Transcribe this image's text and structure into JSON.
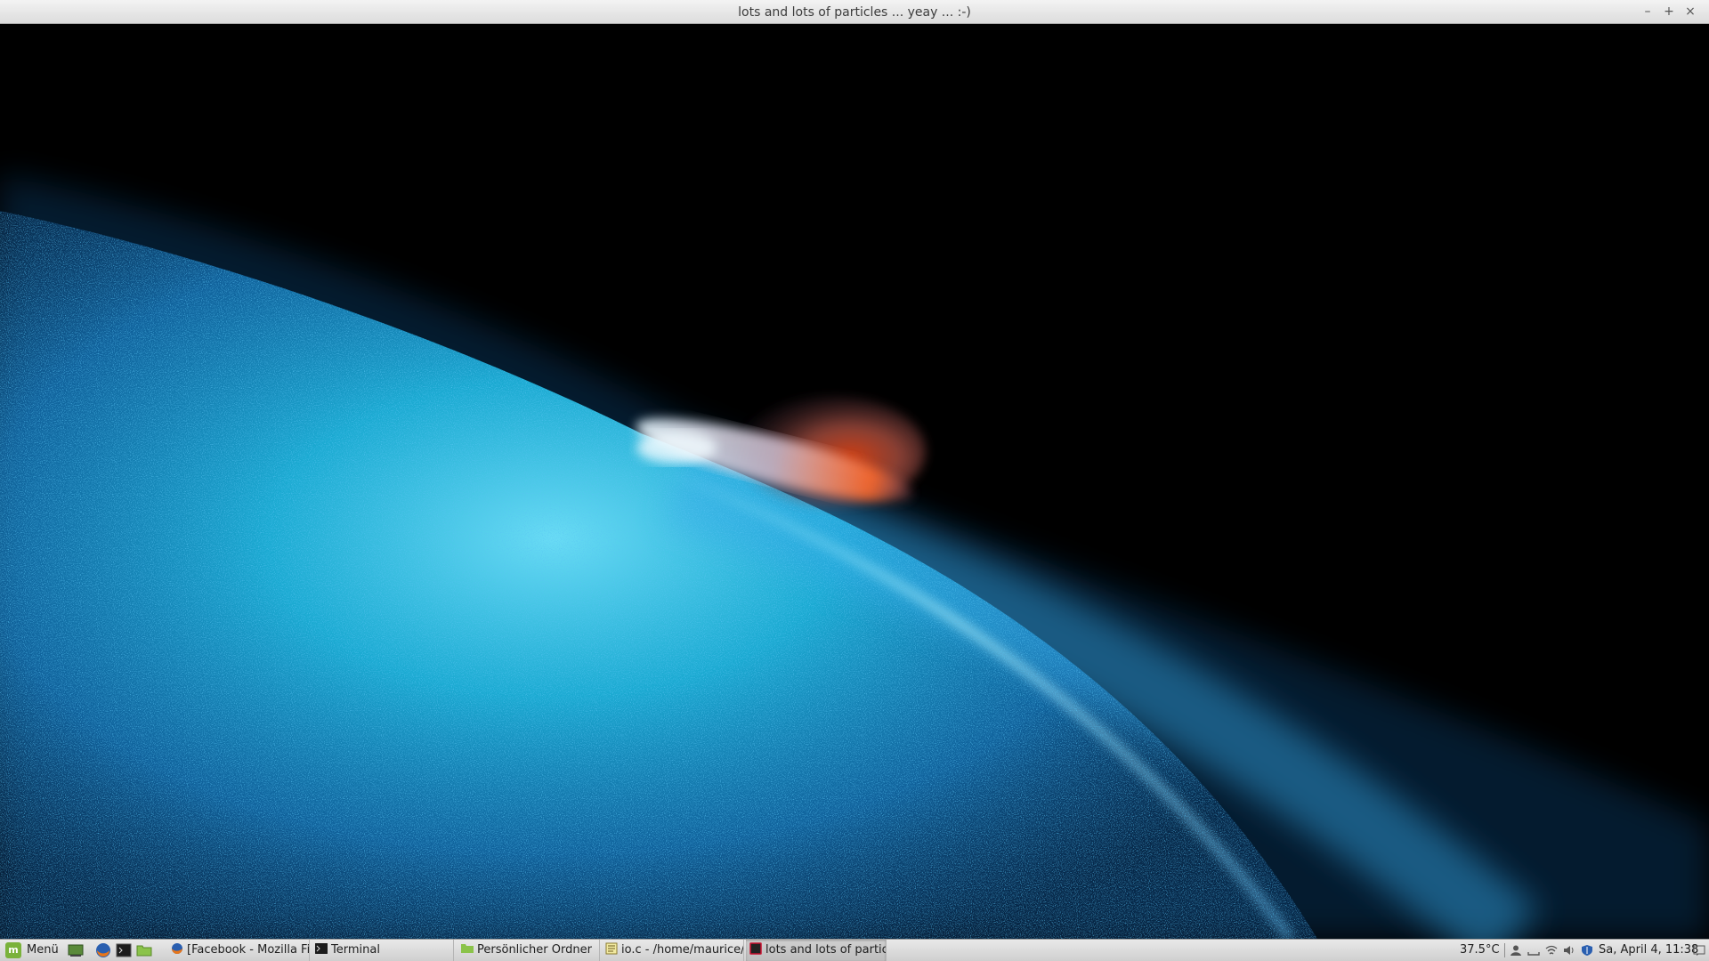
{
  "window": {
    "title": "lots and lots of particles ... yeay ... :-)",
    "controls": {
      "minimize": "–",
      "maximize": "+",
      "close": "×"
    }
  },
  "scene": {
    "background": "#000000",
    "particle_colors": {
      "main_cyan": "#1ec8f0",
      "main_blue": "#1a73c8",
      "bright_core": "#bff5ff",
      "ember_orange": "#ff5a1e",
      "ember_pale": "#e8c8d8"
    }
  },
  "taskbar": {
    "menu_label": "Menü",
    "launchers": [
      "show-desktop-icon",
      "firefox-icon",
      "terminal-icon",
      "files-icon"
    ],
    "tasks": [
      {
        "label": "[Facebook - Mozilla Fi...",
        "icon": "firefox-icon"
      },
      {
        "label": "Terminal",
        "icon": "terminal-icon"
      },
      {
        "label": "Persönlicher Ordner",
        "icon": "folder-icon"
      },
      {
        "label": "io.c - /home/maurice/...",
        "icon": "text-editor-icon"
      },
      {
        "label": "lots and lots of particl...",
        "icon": "app-window-icon"
      }
    ],
    "temperature": "37.5°C",
    "datetime": "Sa, April  4, 11:38",
    "tray_icons": [
      "user-icon",
      "keyboard-icon",
      "wifi-icon",
      "volume-icon",
      "shield-icon",
      "notification-icon"
    ]
  }
}
